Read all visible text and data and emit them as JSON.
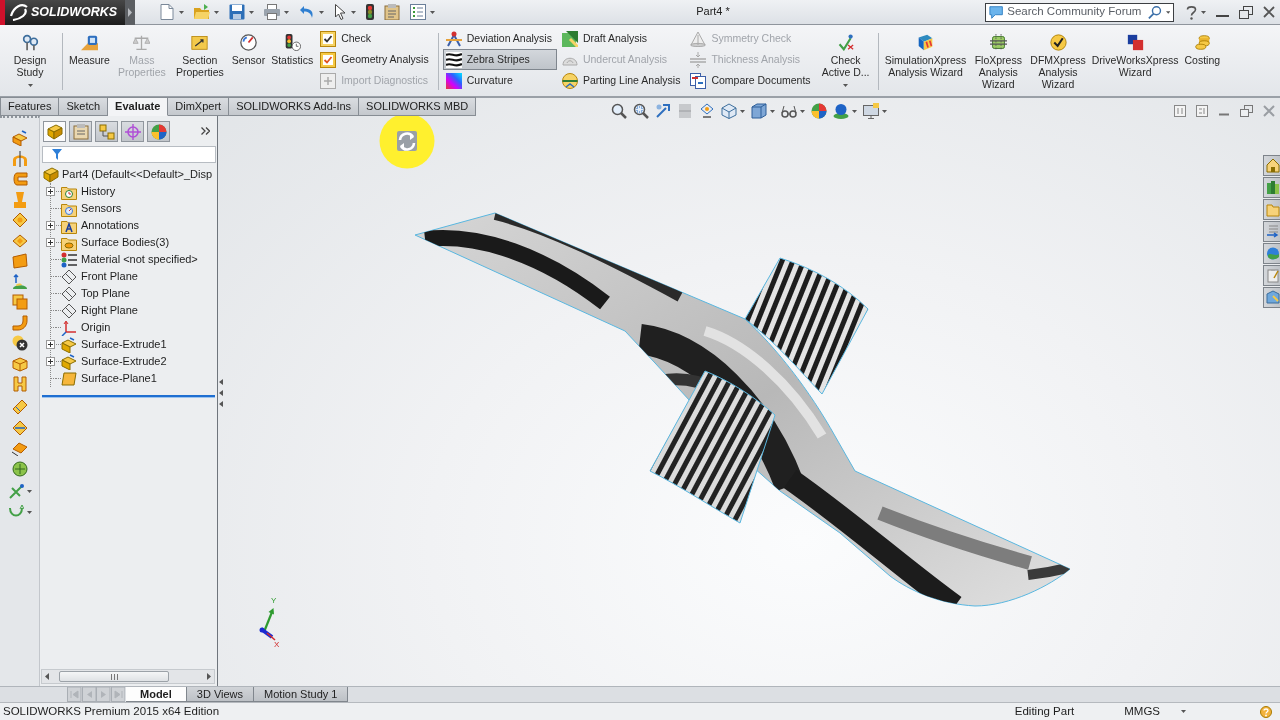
{
  "title_bar": {
    "logo": "SOLIDWORKS",
    "document_title": "Part4 *",
    "search": {
      "placeholder": "Search Community Forum"
    }
  },
  "ribbon": {
    "groups": [
      {
        "items": [
          {
            "kind": "large",
            "label": "Design Study",
            "disabled": false,
            "dropdown": true
          }
        ]
      },
      {
        "items": [
          {
            "kind": "large",
            "label": "Measure",
            "disabled": false,
            "dropdown": false
          },
          {
            "kind": "large",
            "label": "Mass Properties",
            "disabled": true,
            "dropdown": false
          },
          {
            "kind": "large",
            "label": "Section Properties",
            "disabled": false,
            "dropdown": false
          },
          {
            "kind": "large",
            "label": "Sensor",
            "disabled": false,
            "dropdown": false
          },
          {
            "kind": "large",
            "label": "Statistics",
            "disabled": false,
            "dropdown": false
          },
          {
            "kind": "column",
            "buttons": [
              {
                "label": "Check",
                "disabled": false,
                "pressed": false
              },
              {
                "label": "Geometry Analysis",
                "disabled": false,
                "pressed": false
              },
              {
                "label": "Import Diagnostics",
                "disabled": true,
                "pressed": false
              }
            ]
          }
        ]
      },
      {
        "items": [
          {
            "kind": "column",
            "buttons": [
              {
                "label": "Deviation Analysis",
                "disabled": false,
                "pressed": false
              },
              {
                "label": "Zebra Stripes",
                "disabled": false,
                "pressed": true
              },
              {
                "label": "Curvature",
                "disabled": false,
                "pressed": false
              }
            ]
          },
          {
            "kind": "column",
            "buttons": [
              {
                "label": "Draft Analysis",
                "disabled": false,
                "pressed": false
              },
              {
                "label": "Undercut Analysis",
                "disabled": true,
                "pressed": false
              },
              {
                "label": "Parting Line Analysis",
                "disabled": false,
                "pressed": false
              }
            ]
          },
          {
            "kind": "column",
            "buttons": [
              {
                "label": "Symmetry Check",
                "disabled": true,
                "pressed": false
              },
              {
                "label": "Thickness Analysis",
                "disabled": true,
                "pressed": false
              },
              {
                "label": "Compare Documents",
                "disabled": false,
                "pressed": false
              }
            ]
          },
          {
            "kind": "large",
            "label": "Check Active D...",
            "disabled": false,
            "dropdown": true
          }
        ]
      },
      {
        "items": [
          {
            "kind": "large",
            "label": "SimulationXpress Analysis Wizard",
            "disabled": false,
            "dropdown": false
          },
          {
            "kind": "large",
            "label": "FloXpress Analysis Wizard",
            "disabled": false,
            "dropdown": false
          },
          {
            "kind": "large",
            "label": "DFMXpress Analysis Wizard",
            "disabled": false,
            "dropdown": false
          },
          {
            "kind": "large",
            "label": "DriveWorksXpress Wizard",
            "disabled": false,
            "dropdown": false
          },
          {
            "kind": "large",
            "label": "Costing",
            "disabled": false,
            "dropdown": false
          }
        ]
      }
    ]
  },
  "command_tabs": [
    {
      "label": "Features",
      "selected": false
    },
    {
      "label": "Sketch",
      "selected": false
    },
    {
      "label": "Evaluate",
      "selected": true
    },
    {
      "label": "DimXpert",
      "selected": false
    },
    {
      "label": "SOLIDWORKS Add-Ins",
      "selected": false
    },
    {
      "label": "SOLIDWORKS MBD",
      "selected": false
    }
  ],
  "feature_manager": {
    "panel_tabs": [
      {
        "selected": true
      },
      {
        "selected": false
      },
      {
        "selected": false
      },
      {
        "selected": false
      },
      {
        "selected": false
      }
    ],
    "tree": {
      "kind": "part",
      "label": "Part4 (Default<<Default>_Disp",
      "expandable": false,
      "children": [
        {
          "kind": "history",
          "label": "History",
          "expandable": true
        },
        {
          "kind": "sensors",
          "label": "Sensors",
          "expandable": false
        },
        {
          "kind": "annotations",
          "label": "Annotations",
          "expandable": true
        },
        {
          "kind": "bodies",
          "label": "Surface Bodies(3)",
          "expandable": true
        },
        {
          "kind": "material",
          "label": "Material <not specified>",
          "expandable": false
        },
        {
          "kind": "plane",
          "label": "Front Plane",
          "expandable": false
        },
        {
          "kind": "plane",
          "label": "Top Plane",
          "expandable": false
        },
        {
          "kind": "plane",
          "label": "Right Plane",
          "expandable": false
        },
        {
          "kind": "origin",
          "label": "Origin",
          "expandable": false
        },
        {
          "kind": "surface",
          "label": "Surface-Extrude1",
          "expandable": true
        },
        {
          "kind": "surface",
          "label": "Surface-Extrude2",
          "expandable": true
        },
        {
          "kind": "planar",
          "label": "Surface-Plane1",
          "expandable": false
        }
      ]
    }
  },
  "viewport": {
    "axis_labels": [
      "Y",
      "X"
    ]
  },
  "document_tabs": [
    {
      "label": "Model",
      "selected": true
    },
    {
      "label": "3D Views",
      "selected": false
    },
    {
      "label": "Motion Study 1",
      "selected": false
    }
  ],
  "status_bar": {
    "edition": "SOLIDWORKS Premium 2015 x64 Edition",
    "mode": "Editing Part",
    "units": "MMGS"
  }
}
